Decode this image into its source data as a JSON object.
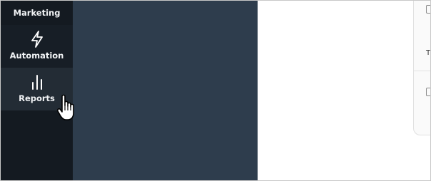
{
  "sidebar": {
    "items": [
      {
        "label": "Marketing",
        "icon": "chevron-icon"
      },
      {
        "label": "Automation",
        "icon": "lightning-icon"
      },
      {
        "label": "Reports",
        "icon": "bar-chart-icon"
      }
    ]
  },
  "card": {
    "text": "T"
  },
  "colors": {
    "sidebar": "#141a21",
    "sidebar_active": "#232c35",
    "panel": "#2e3d4d",
    "content": "#ffffff"
  }
}
